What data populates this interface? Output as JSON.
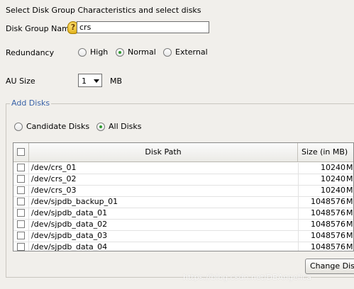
{
  "header": {
    "title": "Select Disk Group Characteristics and select disks"
  },
  "disk_group_name": {
    "label": "Disk Group Name",
    "value": "crs",
    "help_icon": "help-icon"
  },
  "redundancy": {
    "label": "Redundancy",
    "options": [
      {
        "label": "High",
        "selected": false
      },
      {
        "label": "Normal",
        "selected": true
      },
      {
        "label": "External",
        "selected": false
      }
    ]
  },
  "au_size": {
    "label": "AU Size",
    "value": "1",
    "unit": "MB"
  },
  "add_disks": {
    "group_label": "Add Disks",
    "filter_options": [
      {
        "label": "Candidate Disks",
        "selected": false
      },
      {
        "label": "All Disks",
        "selected": true
      }
    ],
    "table": {
      "columns": [
        "Disk Path",
        "Size (in MB)"
      ],
      "rows": [
        {
          "path": "/dev/crs_01",
          "size": "10240",
          "unit": "Me"
        },
        {
          "path": "/dev/crs_02",
          "size": "10240",
          "unit": "Me"
        },
        {
          "path": "/dev/crs_03",
          "size": "10240",
          "unit": "Me"
        },
        {
          "path": "/dev/sjpdb_backup_01",
          "size": "1048576",
          "unit": "Me"
        },
        {
          "path": "/dev/sjpdb_data_01",
          "size": "1048576",
          "unit": "Me"
        },
        {
          "path": "/dev/sjpdb_data_02",
          "size": "1048576",
          "unit": "Me"
        },
        {
          "path": "/dev/sjpdb_data_03",
          "size": "1048576",
          "unit": "Me"
        },
        {
          "path": "/dev/sjpdb_data_04",
          "size": "1048576",
          "unit": "Me"
        }
      ]
    },
    "change_button": "Change Dis"
  },
  "watermark": "https://blog.csdn.net/DBAngelica"
}
